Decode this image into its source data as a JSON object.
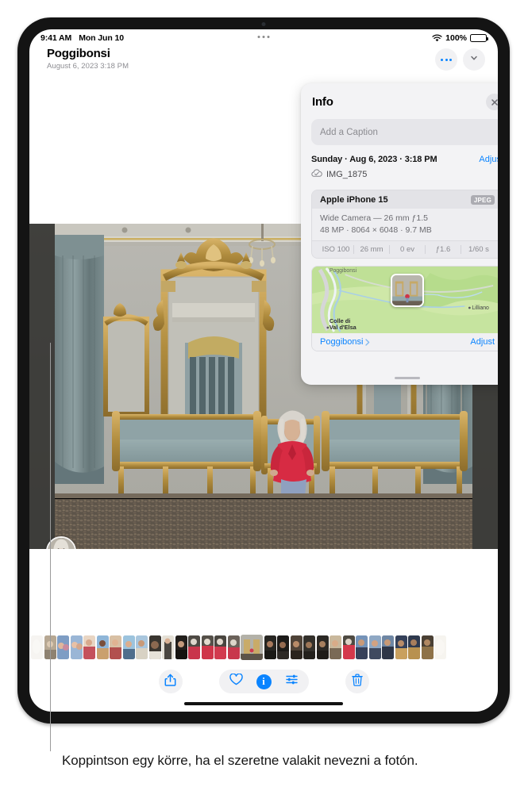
{
  "statusbar": {
    "time": "9:41 AM",
    "date": "Mon Jun 10",
    "battery_pct": "100%",
    "wifi_icon": "wifi-icon",
    "battery_icon": "battery-icon"
  },
  "header": {
    "title": "Poggibonsi",
    "subtitle": "August 6, 2023  3:18 PM",
    "more_icon": "more-dots-icon",
    "chevron_icon": "chevron-down-icon"
  },
  "info_panel": {
    "title": "Info",
    "close_icon": "close-icon",
    "caption_placeholder": "Add a Caption",
    "date_text": "Sunday · Aug 6, 2023 · 3:18 PM",
    "date_adjust_label": "Adjust",
    "cloud_icon": "cloud-check-icon",
    "file_name": "IMG_1875",
    "camera": {
      "model": "Apple iPhone 15",
      "format_tag": "JPEG",
      "lens": "Wide Camera — 26 mm ƒ1.5",
      "specs": "48 MP · 8064 × 6048 · 9.7 MB",
      "exif": [
        "ISO 100",
        "26 mm",
        "0 ev",
        "ƒ1.6",
        "1/60 s"
      ]
    },
    "map": {
      "labels": [
        "Poggibonsi",
        "Colle di",
        "Val d'Elsa",
        "Lilliano"
      ],
      "place_link": "Poggibonsi",
      "chevron_icon": "chevron-right-icon",
      "adjust_label": "Adjust"
    }
  },
  "photo": {
    "face_circle_name": "face-tag-circle"
  },
  "toolbar": {
    "share_icon": "share-icon",
    "favorite_icon": "heart-icon",
    "info_icon": "info-icon",
    "adjust_icon": "adjustments-icon",
    "delete_icon": "trash-icon",
    "info_active": true,
    "accent_color": "#0a84ff"
  },
  "callout": {
    "text": "Koppintson egy körre, ha el szeretne valakit nevezni a fotón."
  }
}
